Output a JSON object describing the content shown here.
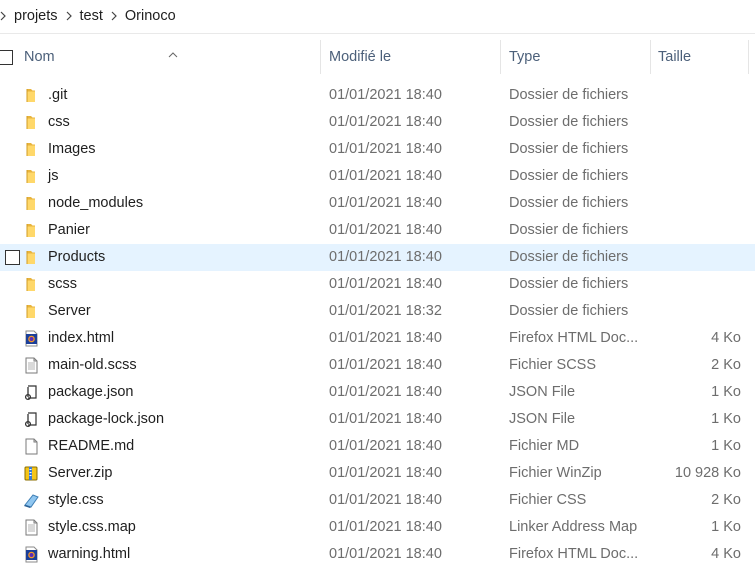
{
  "breadcrumb": {
    "items": [
      "projets",
      "test",
      "Orinoco"
    ]
  },
  "columns": {
    "name": "Nom",
    "modified": "Modifié le",
    "type": "Type",
    "size": "Taille"
  },
  "files": [
    {
      "name": ".git",
      "date": "01/01/2021 18:40",
      "type": "Dossier de fichiers",
      "size": "",
      "icon": "folder-icon"
    },
    {
      "name": "css",
      "date": "01/01/2021 18:40",
      "type": "Dossier de fichiers",
      "size": "",
      "icon": "folder-icon"
    },
    {
      "name": "Images",
      "date": "01/01/2021 18:40",
      "type": "Dossier de fichiers",
      "size": "",
      "icon": "folder-icon"
    },
    {
      "name": "js",
      "date": "01/01/2021 18:40",
      "type": "Dossier de fichiers",
      "size": "",
      "icon": "folder-icon"
    },
    {
      "name": "node_modules",
      "date": "01/01/2021 18:40",
      "type": "Dossier de fichiers",
      "size": "",
      "icon": "folder-icon"
    },
    {
      "name": "Panier",
      "date": "01/01/2021 18:40",
      "type": "Dossier de fichiers",
      "size": "",
      "icon": "folder-icon"
    },
    {
      "name": "Products",
      "date": "01/01/2021 18:40",
      "type": "Dossier de fichiers",
      "size": "",
      "icon": "folder-icon",
      "selected": true
    },
    {
      "name": "scss",
      "date": "01/01/2021 18:40",
      "type": "Dossier de fichiers",
      "size": "",
      "icon": "folder-icon"
    },
    {
      "name": "Server",
      "date": "01/01/2021 18:32",
      "type": "Dossier de fichiers",
      "size": "",
      "icon": "folder-icon"
    },
    {
      "name": "index.html",
      "date": "01/01/2021 18:40",
      "type": "Firefox HTML Doc...",
      "size": "4 Ko",
      "icon": "firefox-html-icon"
    },
    {
      "name": "main-old.scss",
      "date": "01/01/2021 18:40",
      "type": "Fichier SCSS",
      "size": "2 Ko",
      "icon": "text-file-icon"
    },
    {
      "name": "package.json",
      "date": "01/01/2021 18:40",
      "type": "JSON File",
      "size": "1 Ko",
      "icon": "json-file-icon"
    },
    {
      "name": "package-lock.json",
      "date": "01/01/2021 18:40",
      "type": "JSON File",
      "size": "1 Ko",
      "icon": "json-file-icon"
    },
    {
      "name": "README.md",
      "date": "01/01/2021 18:40",
      "type": "Fichier MD",
      "size": "1 Ko",
      "icon": "blank-file-icon"
    },
    {
      "name": "Server.zip",
      "date": "01/01/2021 18:40",
      "type": "Fichier WinZip",
      "size": "10 928 Ko",
      "icon": "winzip-icon"
    },
    {
      "name": "style.css",
      "date": "01/01/2021 18:40",
      "type": "Fichier CSS",
      "size": "2 Ko",
      "icon": "css-file-icon"
    },
    {
      "name": "style.css.map",
      "date": "01/01/2021 18:40",
      "type": "Linker Address Map",
      "size": "1 Ko",
      "icon": "text-file-icon"
    },
    {
      "name": "warning.html",
      "date": "01/01/2021 18:40",
      "type": "Firefox HTML Doc...",
      "size": "4 Ko",
      "icon": "firefox-html-icon"
    }
  ]
}
